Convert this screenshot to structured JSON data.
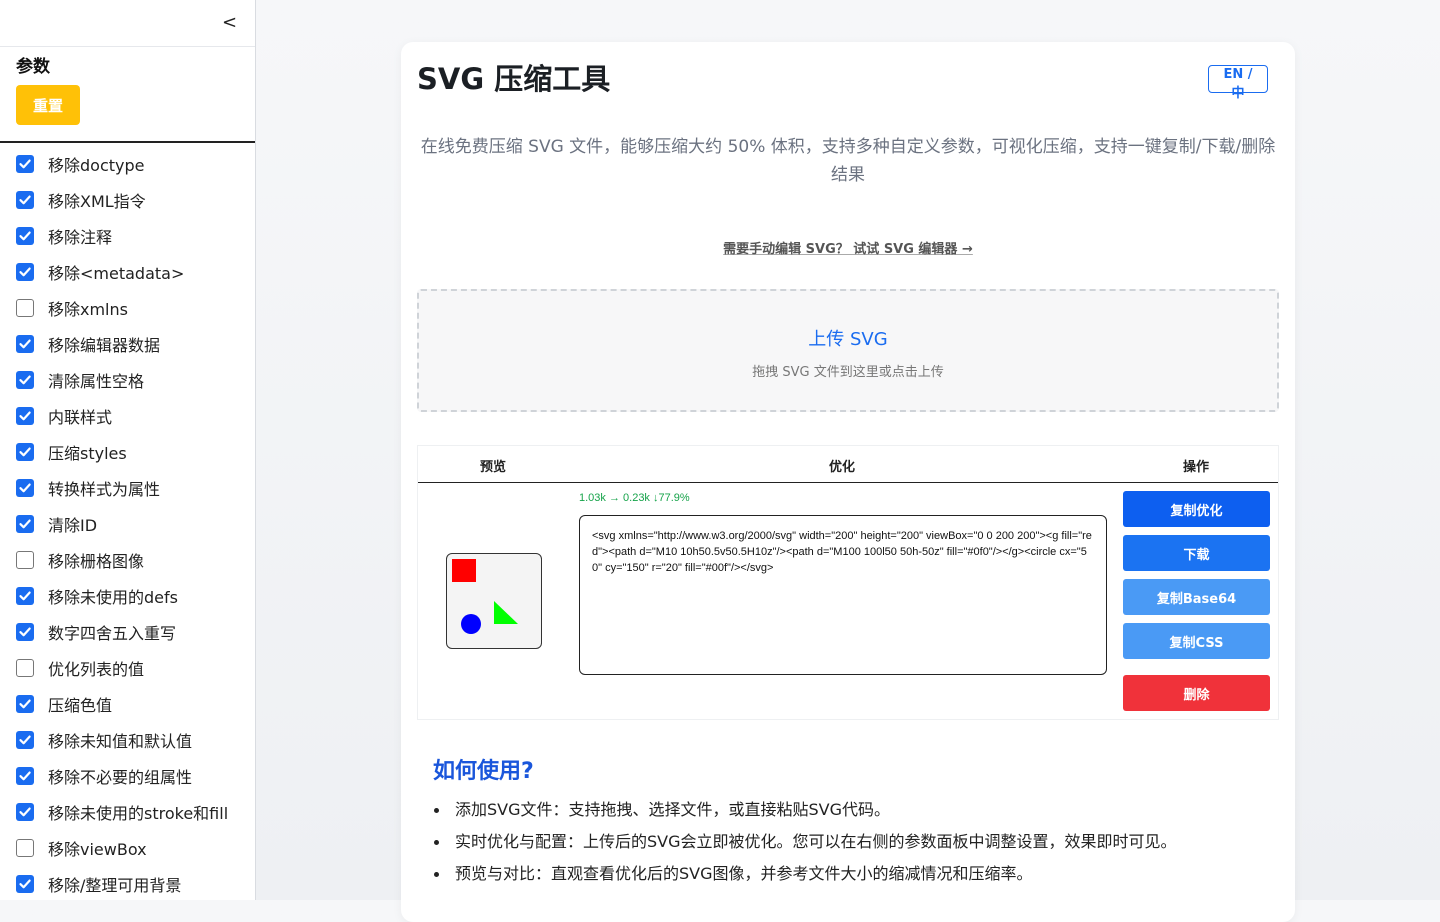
{
  "sidebar": {
    "collapse_glyph": "<",
    "params_title": "参数",
    "reset_label": "重置",
    "options": [
      {
        "label": "移除doctype",
        "checked": true
      },
      {
        "label": "移除XML指令",
        "checked": true
      },
      {
        "label": "移除注释",
        "checked": true
      },
      {
        "label": "移除<metadata>",
        "checked": true
      },
      {
        "label": "移除xmlns",
        "checked": false
      },
      {
        "label": "移除编辑器数据",
        "checked": true
      },
      {
        "label": "清除属性空格",
        "checked": true
      },
      {
        "label": "内联样式",
        "checked": true
      },
      {
        "label": "压缩styles",
        "checked": true
      },
      {
        "label": "转换样式为属性",
        "checked": true
      },
      {
        "label": "清除ID",
        "checked": true
      },
      {
        "label": "移除栅格图像",
        "checked": false
      },
      {
        "label": "移除未使用的defs",
        "checked": true
      },
      {
        "label": "数字四舍五入重写",
        "checked": true
      },
      {
        "label": "优化列表的值",
        "checked": false
      },
      {
        "label": "压缩色值",
        "checked": true
      },
      {
        "label": "移除未知值和默认值",
        "checked": true
      },
      {
        "label": "移除不必要的组属性",
        "checked": true
      },
      {
        "label": "移除未使用的stroke和fill",
        "checked": true
      },
      {
        "label": "移除viewBox",
        "checked": false
      },
      {
        "label": "移除/整理可用背景",
        "checked": true
      }
    ]
  },
  "main": {
    "title": "SVG 压缩工具",
    "lang_label": "EN / 中",
    "description": "在线免费压缩 SVG 文件，能够压缩大约 50% 体积，支持多种自定义参数，可视化压缩，支持一键复制/下载/删除结果",
    "editor_link": "需要手动编辑 SVG？ 试试 SVG 编辑器 →",
    "upload": {
      "title": "上传 SVG",
      "hint": "拖拽 SVG 文件到这里或点击上传"
    },
    "table": {
      "headers": {
        "preview": "预览",
        "optimize": "优化",
        "actions": "操作"
      },
      "row": {
        "ratio": "1.03k → 0.23k ↓77.9%",
        "code": "<svg xmlns=\"http://www.w3.org/2000/svg\" width=\"200\" height=\"200\" viewBox=\"0 0 200 200\"><g fill=\"red\"><path d=\"M10 10h50.5v50.5H10z\"/><path d=\"M100 100l50 50h-50z\" fill=\"#0f0\"/></g><circle cx=\"50\" cy=\"150\" r=\"20\" fill=\"#00f\"/></svg>",
        "actions": {
          "copy_optimized": "复制优化",
          "download": "下载",
          "copy_base64": "复制Base64",
          "copy_css": "复制CSS",
          "delete": "删除"
        }
      }
    },
    "how_to": {
      "title": "如何使用?",
      "items": [
        "添加SVG文件：支持拖拽、选择文件，或直接粘贴SVG代码。",
        "实时优化与配置：上传后的SVG会立即被优化。您可以在右侧的参数面板中调整设置，效果即时可见。",
        "预览与对比：直观查看优化后的SVG图像，并参考文件大小的缩减情况和压缩率。"
      ]
    }
  },
  "colors": {
    "accent": "#1a6cf0",
    "reset": "#ffc107",
    "copy_optimized": "#0d5ff0",
    "download": "#1b73f2",
    "copy_base64": "#4a9af5",
    "copy_css": "#4a9af5",
    "delete": "#f0323a",
    "ratio_green": "#16a34a"
  }
}
